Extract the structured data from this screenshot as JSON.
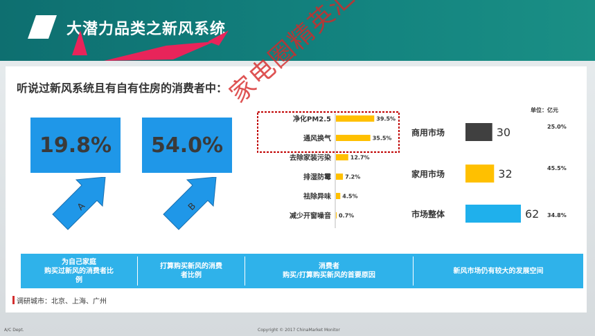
{
  "header": {
    "title": "大潜力品类之新风系统"
  },
  "subtitle": "听说过新风系统且有自有住房的消费者中：",
  "stats": [
    {
      "value": "19.8%",
      "arrow_label": "A"
    },
    {
      "value": "54.0%",
      "arrow_label": "B"
    }
  ],
  "unit": "单位：亿元",
  "chart_data": [
    {
      "type": "bar",
      "orientation": "horizontal",
      "categories": [
        "净化PM2.5",
        "通风换气",
        "去除家装污染",
        "排湿防霉",
        "祛除异味",
        "减少开窗噪音"
      ],
      "values": [
        39.5,
        35.5,
        12.7,
        7.2,
        4.5,
        0.7
      ],
      "value_labels": [
        "39.5%",
        "35.5%",
        "12.7%",
        "7.2%",
        "4.5%",
        "0.7%"
      ],
      "highlighted": [
        "净化PM2.5",
        "通风换气"
      ],
      "bar_color": "#ffc000"
    },
    {
      "type": "bar",
      "orientation": "horizontal",
      "categories": [
        "商用市场",
        "家用市场",
        "市场整体"
      ],
      "values": [
        30,
        32,
        62
      ],
      "value_labels": [
        "30",
        "32",
        "62"
      ],
      "growth_labels": [
        "25.0%",
        "45.5%",
        "34.8%"
      ],
      "bar_colors": [
        "#404040",
        "#ffc000",
        "#1fb0ec"
      ]
    }
  ],
  "bottom_bar": [
    "为自己家庭\n购买过新风的消费者比\n例",
    "打算购买新风的消费\n者比例",
    "消费者\n购买/打算购买新风的首要原因",
    "新风市场仍有较大的发展空间"
  ],
  "cities": "调研城市：北京、上海、广州",
  "footer": {
    "left": "A/C Dept.",
    "center": "Copyright © 2017 ChinaMarket Monitor"
  },
  "watermark": "家电圈精英汇",
  "colors": {
    "header": "#13837f",
    "stat_box": "#1f97e8",
    "bottom_bar": "#2fb2ea",
    "highlight_border": "#c00000",
    "decor_red": "#e8245a"
  }
}
